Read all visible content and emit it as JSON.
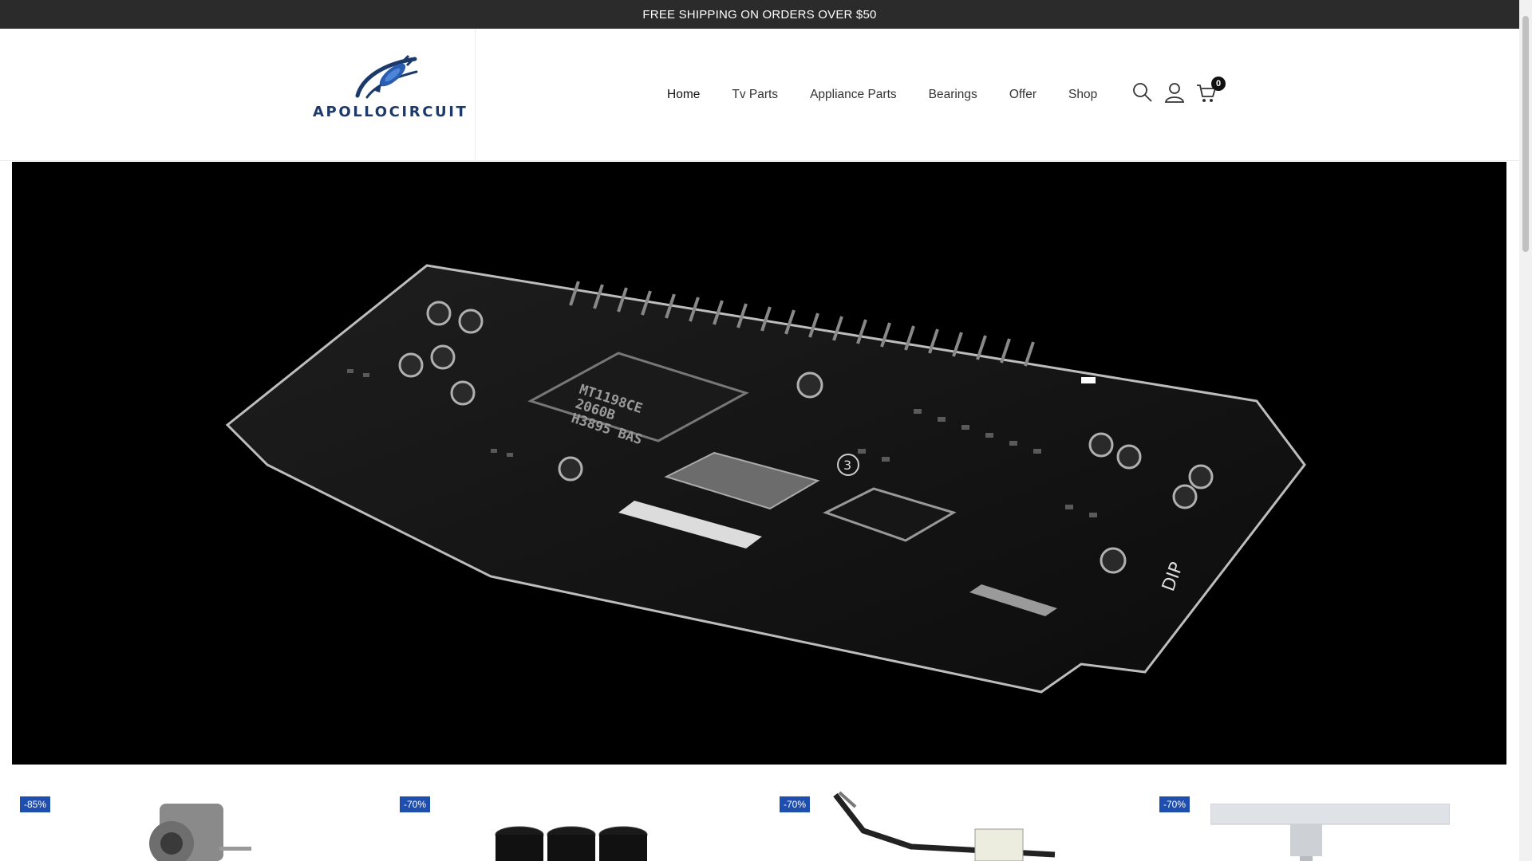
{
  "announcement": "FREE SHIPPING ON ORDERS OVER $50",
  "brand": {
    "name": "APOLLOCIRCUIT",
    "color": "#1b3a6b"
  },
  "nav": [
    {
      "label": "Home",
      "active": true
    },
    {
      "label": "Tv Parts"
    },
    {
      "label": "Appliance Parts"
    },
    {
      "label": "Bearings"
    },
    {
      "label": "Offer"
    },
    {
      "label": "Shop"
    }
  ],
  "header_icons": {
    "search": "search-icon",
    "account": "user-icon",
    "cart": "cart-icon",
    "cart_count": "0"
  },
  "hero": {
    "chip_text_1": "MT1198CE",
    "chip_text_2": "2060B",
    "chip_text_3": "H3895 BAS",
    "board_mark": "DIP",
    "board_number": "3"
  },
  "products": [
    {
      "discount": "-85%"
    },
    {
      "discount": "-70%"
    },
    {
      "discount": "-70%"
    },
    {
      "discount": "-70%"
    }
  ],
  "colors": {
    "accent": "#1e4fae",
    "announce_bg": "#2b2b2b",
    "hero_bg": "#000000"
  }
}
